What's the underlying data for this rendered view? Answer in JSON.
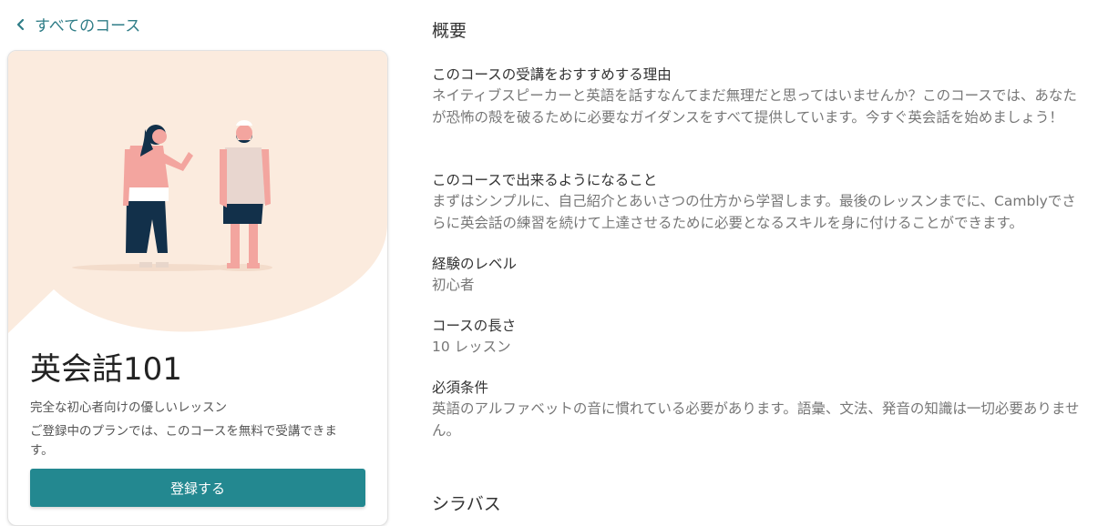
{
  "nav": {
    "back_label": "すべてのコース"
  },
  "card": {
    "title": "英会話101",
    "subtitle": "完全な初心者向けの優しいレッスン",
    "plan_note": "ご登録中のプランでは、このコースを無料で受講できます。",
    "enroll_label": "登録する",
    "colors": {
      "bubble": "#fbebde",
      "button": "#238890"
    }
  },
  "overview": {
    "heading": "概要",
    "fields": [
      {
        "label": "このコースの受講をおすすめする理由",
        "value": "ネイティブスピーカーと英語を話すなんてまだ無理だと思ってはいませんか？このコースでは、あなたが恐怖の殻を破るために必要なガイダンスをすべて提供しています。今すぐ英会話を始めましょう！"
      },
      {
        "label": "このコースで出来るようになること",
        "value": "まずはシンプルに、自己紹介とあいさつの仕方から学習します。最後のレッスンまでに、Camblyでさらに英会話の練習を続けて上達させるために必要となるスキルを身に付けることができます。"
      },
      {
        "label": "経験のレベル",
        "value": "初心者"
      },
      {
        "label": "コースの長さ",
        "value": "10 レッスン"
      },
      {
        "label": "必須条件",
        "value": "英語のアルファベットの音に慣れている必要があります。語彙、文法、発音の知識は一切必要ありません。"
      }
    ]
  },
  "syllabus": {
    "heading": "シラバス"
  }
}
